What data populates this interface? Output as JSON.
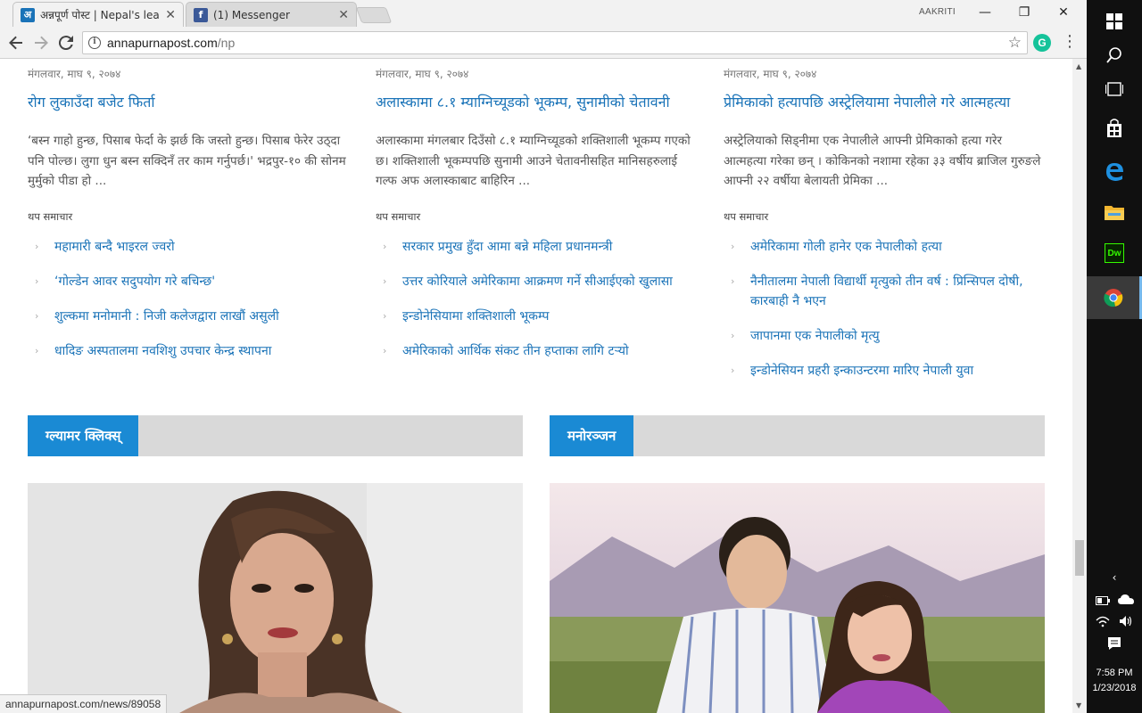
{
  "browser": {
    "tabs": [
      {
        "favicon": "अ",
        "favicon_color": "#1a73b8",
        "label": "अन्नपूर्ण पोस्ट | Nepal's lea"
      },
      {
        "favicon": "f",
        "favicon_color": "#3b5998",
        "label": "(1) Messenger"
      }
    ],
    "user": "AAKRITI",
    "window_controls": {
      "minimize": "—",
      "restore": "❐",
      "close": "✕"
    },
    "url_host": "annapurnapost.com",
    "url_path": "/np",
    "grammarly": "G",
    "status_url": "annapurnapost.com/news/89058"
  },
  "columns": [
    {
      "date": "मंगलवार, माघ ९, २०७४",
      "title": "रोग लुकाउँदा बजेट फिर्ता",
      "summary": "‘बस्न गाहो हुन्छ, पिसाब फेर्दा के झर्छ कि जस्तो हुन्छ। पिसाब फेरेर उठ्दा पनि पोल्छ। लुगा धुन बस्न सक्दिनँ तर काम गर्नुपर्छ।' भद्रपुर-१० की सोनम मुर्मुको पीडा हो ...",
      "more_label": "थप समाचार",
      "related": [
        "महामारी बन्दै भाइरल ज्वरो",
        "‘गोल्डेन आवर सदुपयोग गरे बचिन्छ'",
        "शुल्कमा मनोमानी : निजी कलेजद्वारा लाखौं असुली",
        "धादिङ अस्पतालमा नवशिशु उपचार केन्द्र स्थापना"
      ]
    },
    {
      "date": "मंगलवार, माघ ९, २०७४",
      "title": "अलास्कामा ८.१ म्याग्निच्यूडको भूकम्प, सुनामीको चेतावनी",
      "summary": "अलास्कामा मंगलबार दिउँसो ८.१ म्याग्निच्यूडको शक्तिशाली भूकम्प गएको छ। शक्तिशाली भूकम्पपछि सुनामी आउने चेतावनीसहित मानिसहरुलाई गल्फ अफ अलास्काबाट बाहिरिन ...",
      "more_label": "थप समाचार",
      "related": [
        "सरकार प्रमुख हुँदा आमा बन्ने महिला प्रधानमन्त्री",
        "उत्तर कोरियाले अमेरिकामा आक्रमण गर्ने सीआईएको खुलासा",
        "इन्डोनेसियामा शक्तिशाली भूकम्प",
        "अमेरिकाको आर्थिक संकट तीन हप्ताका लागि टर्‍यो"
      ]
    },
    {
      "date": "मंगलवार, माघ ९, २०७४",
      "title": "प्रेमिकाको हत्यापछि अस्ट्रेलियामा नेपालीले गरे आत्महत्या",
      "summary": "अस्ट्रेलियाको सिड्नीमा एक नेपालीले आफ्नी प्रेमिकाको हत्या गरेर आत्महत्या गरेका छन् । कोकिनको नशामा रहेका ३३ वर्षीय ब्राजिल गुरुङले आफ्नी २२ वर्षीया बेलायती प्रेमिका ...",
      "more_label": "थप समाचार",
      "related": [
        "अमेरिकामा गोली हानेर एक नेपालीको हत्या",
        "नैनीतालमा नेपाली विद्यार्थी मृत्युको तीन वर्ष : प्रिन्सिपल दोषी, कारबाही नै भएन",
        "जापानमा एक नेपालीको मृत्यु",
        "इन्डोनेसियन प्रहरी इन्काउन्टरमा मारिए नेपाली युवा"
      ]
    }
  ],
  "sections": [
    {
      "label": "ग्ल्यामर क्लिक्स्"
    },
    {
      "label": "मनोरञ्जन"
    }
  ],
  "taskbar": {
    "time": "7:58 PM",
    "date": "1/23/2018",
    "apps": [
      "windows-icon",
      "search-icon",
      "task-view-icon",
      "store-icon",
      "edge-icon",
      "file-explorer-icon",
      "dreamweaver-icon",
      "chrome-icon"
    ],
    "dreamweaver_label": "Dw"
  },
  "colors": {
    "link": "#1a73b8",
    "section_accent": "#1a8ad4",
    "taskbar": "#101010"
  }
}
